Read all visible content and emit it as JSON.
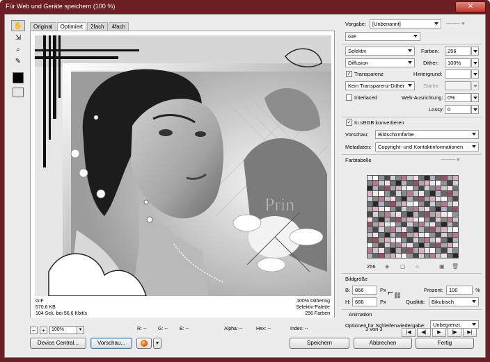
{
  "window": {
    "title": "Für Web und Geräte speichern (100 %)",
    "close_glyph": "✕"
  },
  "tabs": [
    {
      "label": "Original"
    },
    {
      "label": "Optimiert"
    },
    {
      "label": "2fach"
    },
    {
      "label": "4fach"
    }
  ],
  "preview": {
    "watermark_text": "Prin",
    "info_left": [
      "GIF",
      "570,6 KB",
      "104 Sek. bei 56,6 Kbit/s"
    ],
    "info_right": [
      "100% Dithering",
      "Selektiv-Palette",
      "256 Farben"
    ]
  },
  "statusbar": {
    "zoom_minus": "−",
    "zoom_plus": "+",
    "zoom_value": "100%",
    "r": "R: --",
    "g": "G: --",
    "b": "B: --",
    "alpha": "Alpha: --",
    "hex": "Hex: --",
    "index": "Index: --"
  },
  "buttons": {
    "device_central": "Device Central...",
    "preview": "Vorschau...",
    "save": "Speichern",
    "cancel": "Abbrechen",
    "done": "Fertig"
  },
  "panel": {
    "preset_label": "Vorgabe:",
    "preset_value": "[Unbenannt]",
    "format_value": "GIF",
    "reduction_value": "Selektiv",
    "colors_label": "Farben:",
    "colors_value": "256",
    "dither_algo_value": "Diffusion",
    "dither_label": "Dither:",
    "dither_value": "100%",
    "transparency_label": "Transparenz",
    "transparency_checked": "✓",
    "matte_label": "Hintergrund:",
    "matte_value": "",
    "transparency_dither_value": "Kein Transparenz-Dither",
    "amount_label": "Stärke:",
    "amount_value": "",
    "interlaced_label": "Interlaced",
    "interlaced_checked": "",
    "websnap_label": "Web-Ausrichtung:",
    "websnap_value": "0%",
    "lossy_label": "Lossy:",
    "lossy_value": "0",
    "srgb_label": "In sRGB konvertieren",
    "srgb_checked": "✓",
    "preview_label": "Vorschau:",
    "preview_value": "Bildschirmfarbe",
    "metadata_label": "Metadaten:",
    "metadata_value": "Copyright- und Kontaktinformationen",
    "color_table_label": "Farbtabelle",
    "color_count": "256",
    "image_size_label": "Bildgröße",
    "width_label": "B:",
    "width_value": "866",
    "height_label": "H:",
    "height_value": "666",
    "unit_px": "Px",
    "percent_label": "Prozent:",
    "percent_value": "100",
    "percent_unit": "%",
    "quality_label": "Qualität:",
    "quality_value": "Bikubisch",
    "animation_label": "Animation",
    "loop_label": "Optionen für Schleifenwiedergabe:",
    "loop_value": "Unbegrenzt",
    "frame_counter": "3 von 3"
  },
  "colors": {
    "accent": "#6b1e24",
    "palette": [
      "#e8e8e8",
      "#c8c8c8",
      "#a8a8a8",
      "#888888",
      "#686868",
      "#484848",
      "#282828",
      "#ffffff",
      "#f0e0e8",
      "#d8b0c0",
      "#b87890",
      "#985068",
      "#d0d0d8",
      "#b0b0c0",
      "#909098",
      "#707078"
    ]
  }
}
